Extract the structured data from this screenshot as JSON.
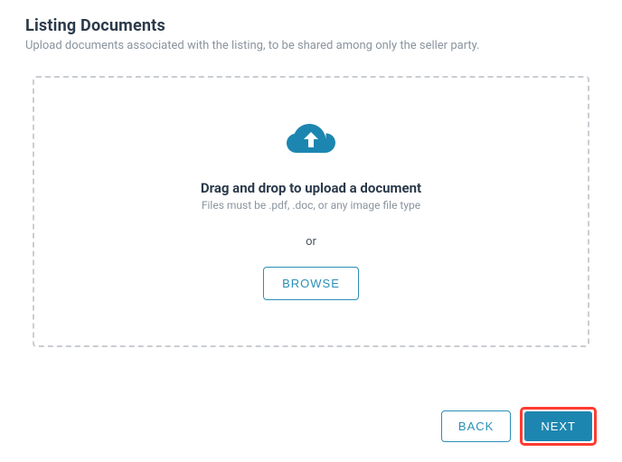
{
  "header": {
    "title": "Listing Documents",
    "subtitle": "Upload documents associated with the listing, to be shared among only the seller party."
  },
  "dropzone": {
    "heading": "Drag and drop to upload a document",
    "subtext": "Files must be .pdf, .doc, or any image file type",
    "or_label": "or",
    "browse_label": "BROWSE"
  },
  "footer": {
    "back_label": "BACK",
    "next_label": "NEXT"
  },
  "colors": {
    "accent": "#1d86b0",
    "highlight": "#ff3b30"
  }
}
